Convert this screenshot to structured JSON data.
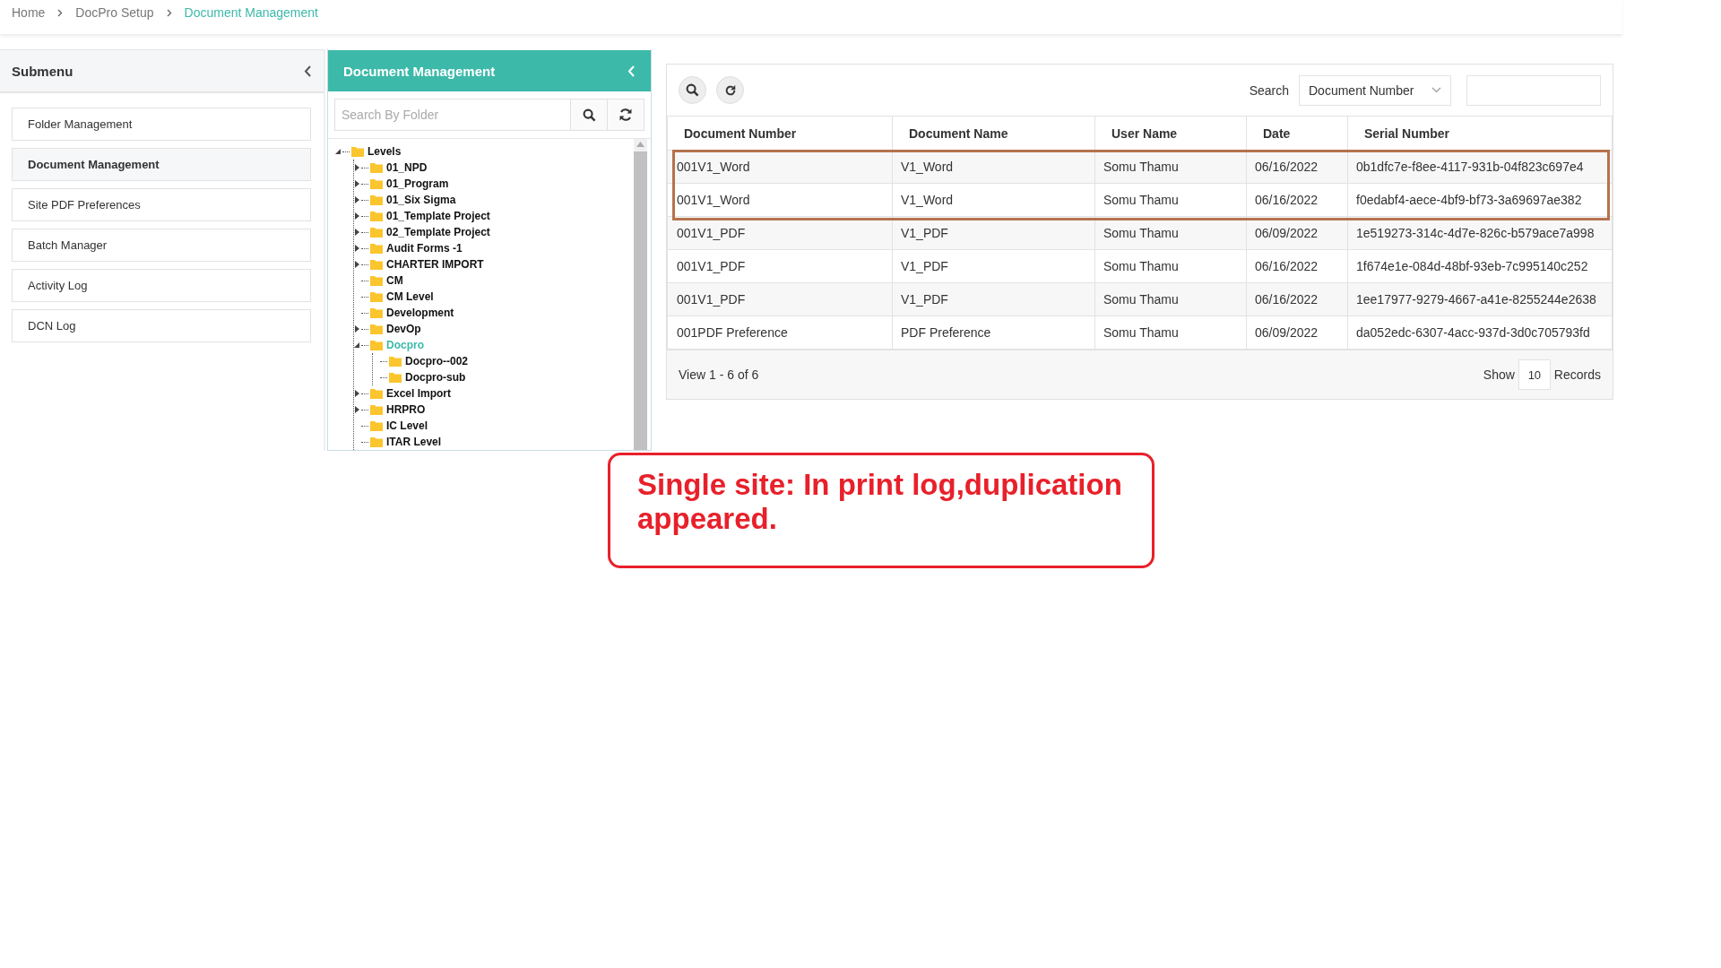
{
  "breadcrumb": [
    {
      "label": "Home",
      "current": false
    },
    {
      "label": "DocPro Setup",
      "current": false
    },
    {
      "label": "Document Management",
      "current": true
    }
  ],
  "submenu": {
    "title": "Submenu",
    "items": [
      {
        "label": "Folder Management",
        "selected": false
      },
      {
        "label": "Document Management",
        "selected": true
      },
      {
        "label": "Site PDF Preferences",
        "selected": false
      },
      {
        "label": "Batch Manager",
        "selected": false
      },
      {
        "label": "Activity Log",
        "selected": false
      },
      {
        "label": "DCN Log",
        "selected": false
      }
    ]
  },
  "folder_panel": {
    "title": "Document Management",
    "search": {
      "placeholder": "Search By Folder"
    },
    "tree": [
      {
        "label": "Levels",
        "selected": false,
        "expanded": true,
        "children": [
          {
            "label": "01_NPD",
            "selected": false,
            "expanded": false
          },
          {
            "label": "01_Program",
            "selected": false,
            "expanded": false
          },
          {
            "label": "01_Six Sigma",
            "selected": false,
            "expanded": false
          },
          {
            "label": "01_Template Project",
            "selected": false,
            "expanded": false
          },
          {
            "label": "02_Template Project",
            "selected": false,
            "expanded": false
          },
          {
            "label": "Audit Forms -1",
            "selected": false,
            "expanded": false
          },
          {
            "label": "CHARTER IMPORT",
            "selected": false,
            "expanded": false
          },
          {
            "label": "CM",
            "selected": false
          },
          {
            "label": "CM Level",
            "selected": false
          },
          {
            "label": "Development",
            "selected": false
          },
          {
            "label": "DevOp",
            "selected": false,
            "expanded": false
          },
          {
            "label": "Docpro",
            "selected": true,
            "expanded": true,
            "children": [
              {
                "label": "Docpro--002",
                "selected": false
              },
              {
                "label": "Docpro-sub",
                "selected": false
              }
            ]
          },
          {
            "label": "Excel Import",
            "selected": false,
            "expanded": false
          },
          {
            "label": "HRPRO",
            "selected": false,
            "expanded": false
          },
          {
            "label": "IC Level",
            "selected": false
          },
          {
            "label": "ITAR Level",
            "selected": false
          }
        ]
      }
    ]
  },
  "table": {
    "search_label": "Search",
    "search_field": {
      "value": "Document Number"
    },
    "columns": [
      "Document Number",
      "Document Name",
      "User Name",
      "Date",
      "Serial Number"
    ],
    "rows": [
      {
        "cells": [
          "001V1_Word",
          "V1_Word",
          "Somu Thamu",
          "06/16/2022",
          "0b1dfc7e-f8ee-4117-931b-04f823c697e4"
        ],
        "highlighted": true
      },
      {
        "cells": [
          "001V1_Word",
          "V1_Word",
          "Somu Thamu",
          "06/16/2022",
          "f0edabf4-aece-4bf9-bf73-3a69697ae382"
        ],
        "highlighted": true
      },
      {
        "cells": [
          "001V1_PDF",
          "V1_PDF",
          "Somu Thamu",
          "06/09/2022",
          "1e519273-314c-4d7e-826c-b579ace7a998"
        ],
        "highlighted": false
      },
      {
        "cells": [
          "001V1_PDF",
          "V1_PDF",
          "Somu Thamu",
          "06/16/2022",
          "1f674e1e-084d-48bf-93eb-7c995140c252"
        ],
        "highlighted": false
      },
      {
        "cells": [
          "001V1_PDF",
          "V1_PDF",
          "Somu Thamu",
          "06/16/2022",
          "1ee17977-9279-4667-a41e-8255244e2638"
        ],
        "highlighted": false
      },
      {
        "cells": [
          "001PDF Preference",
          "PDF Preference",
          "Somu Thamu",
          "06/09/2022",
          "da052edc-6307-4acc-937d-3d0c705793fd"
        ],
        "highlighted": false
      }
    ],
    "footer": {
      "view": "View 1 - 6 of 6",
      "show_label": "Show",
      "page_size": "10",
      "records_label": "Records"
    }
  },
  "note": {
    "text": "Single site: In print log,duplication appeared."
  }
}
